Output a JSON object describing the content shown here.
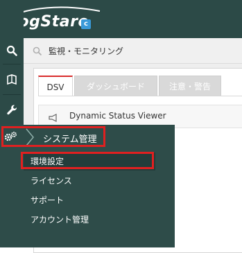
{
  "app": {
    "logo_text": "LogStare",
    "logo_badge": "c"
  },
  "search": {
    "text": "監視・モニタリング"
  },
  "tabs": [
    {
      "label": "DSV",
      "active": true
    },
    {
      "label": "ダッシュボード",
      "active": false
    },
    {
      "label": "注意・警告",
      "active": false
    }
  ],
  "viewer": {
    "title": "Dynamic Status Viewer"
  },
  "flyout": {
    "title": "システム管理",
    "items": [
      {
        "label": "環境設定",
        "selected": true
      },
      {
        "label": "ライセンス",
        "selected": false
      },
      {
        "label": "サポート",
        "selected": false
      },
      {
        "label": "アカウント管理",
        "selected": false
      }
    ]
  },
  "colors": {
    "sidebar": "#2c4a47",
    "highlight": "#e02020",
    "tab_active_accent": "#d92b2b",
    "badge": "#3a9ad9"
  }
}
